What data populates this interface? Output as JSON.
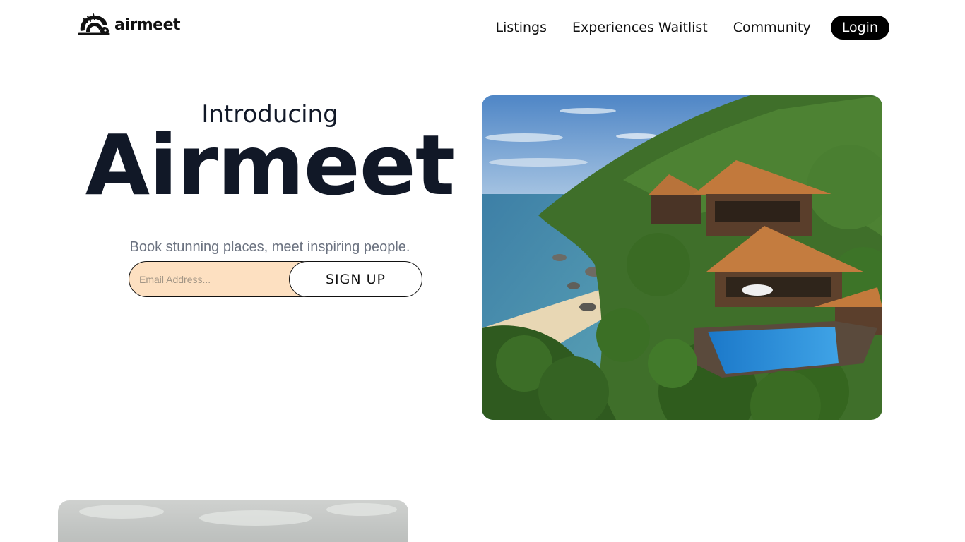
{
  "header": {
    "logo_text": "airmeet",
    "nav": {
      "listings": "Listings",
      "experiences": "Experiences Waitlist",
      "community": "Community",
      "login": "Login"
    }
  },
  "hero": {
    "intro": "Introducing",
    "brand": "Airmeet",
    "tagline": "Book stunning places, meet inspiring people.",
    "email_placeholder": "Email Address...",
    "email_value": "",
    "signup_label": "SIGN UP"
  },
  "colors": {
    "accent_input": "#fde0c1",
    "text_dark": "#111827",
    "text_muted": "#6b7280",
    "login_bg": "#000000"
  },
  "images": {
    "hero": "tropical-cliffside-villas-photo",
    "second": "overcast-sky-photo"
  }
}
